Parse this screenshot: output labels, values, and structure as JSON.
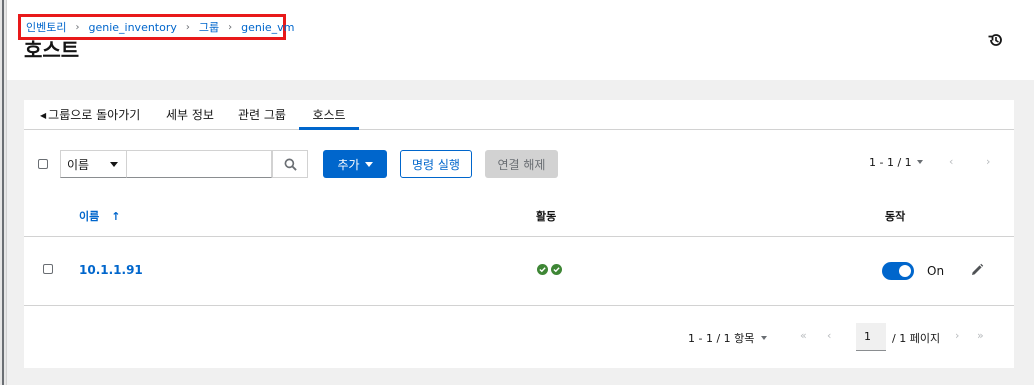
{
  "breadcrumb": {
    "items": [
      "인벤토리",
      "genie_inventory",
      "그룹",
      "genie_vm"
    ],
    "separator": "›"
  },
  "page_title": "호스트",
  "header_icons": {
    "history": "history-icon"
  },
  "tabs": {
    "back": "그룹으로 돌아가기",
    "details": "세부 정보",
    "related_groups": "관련 그룹",
    "hosts": "호스트",
    "active": "호스트"
  },
  "toolbar": {
    "search_field": "이름",
    "search_value": "",
    "search_icon": "search-icon",
    "add_label": "추가",
    "run_command_label": "명령 실행",
    "disassociate_label": "연결 해제",
    "pagination_label": "1 - 1 / 1",
    "prev_icon": "‹",
    "next_icon": "›"
  },
  "table": {
    "columns": {
      "name": "이름",
      "activity": "활동",
      "actions": "동작"
    },
    "sort_icon": "↑",
    "rows": [
      {
        "name": "10.1.1.91",
        "activity_statuses": [
          "success",
          "success"
        ],
        "enabled": true,
        "toggle_label": "On"
      }
    ]
  },
  "pagination": {
    "items_label": "1 - 1 / 1 항목",
    "page": "1",
    "page_of": "/ 1 페이지",
    "first_icon": "«",
    "prev_icon": "‹",
    "next_icon": "›",
    "last_icon": "»"
  },
  "colors": {
    "accent": "#0066cc",
    "success": "#3e8635",
    "highlight_border": "#e8191a"
  }
}
